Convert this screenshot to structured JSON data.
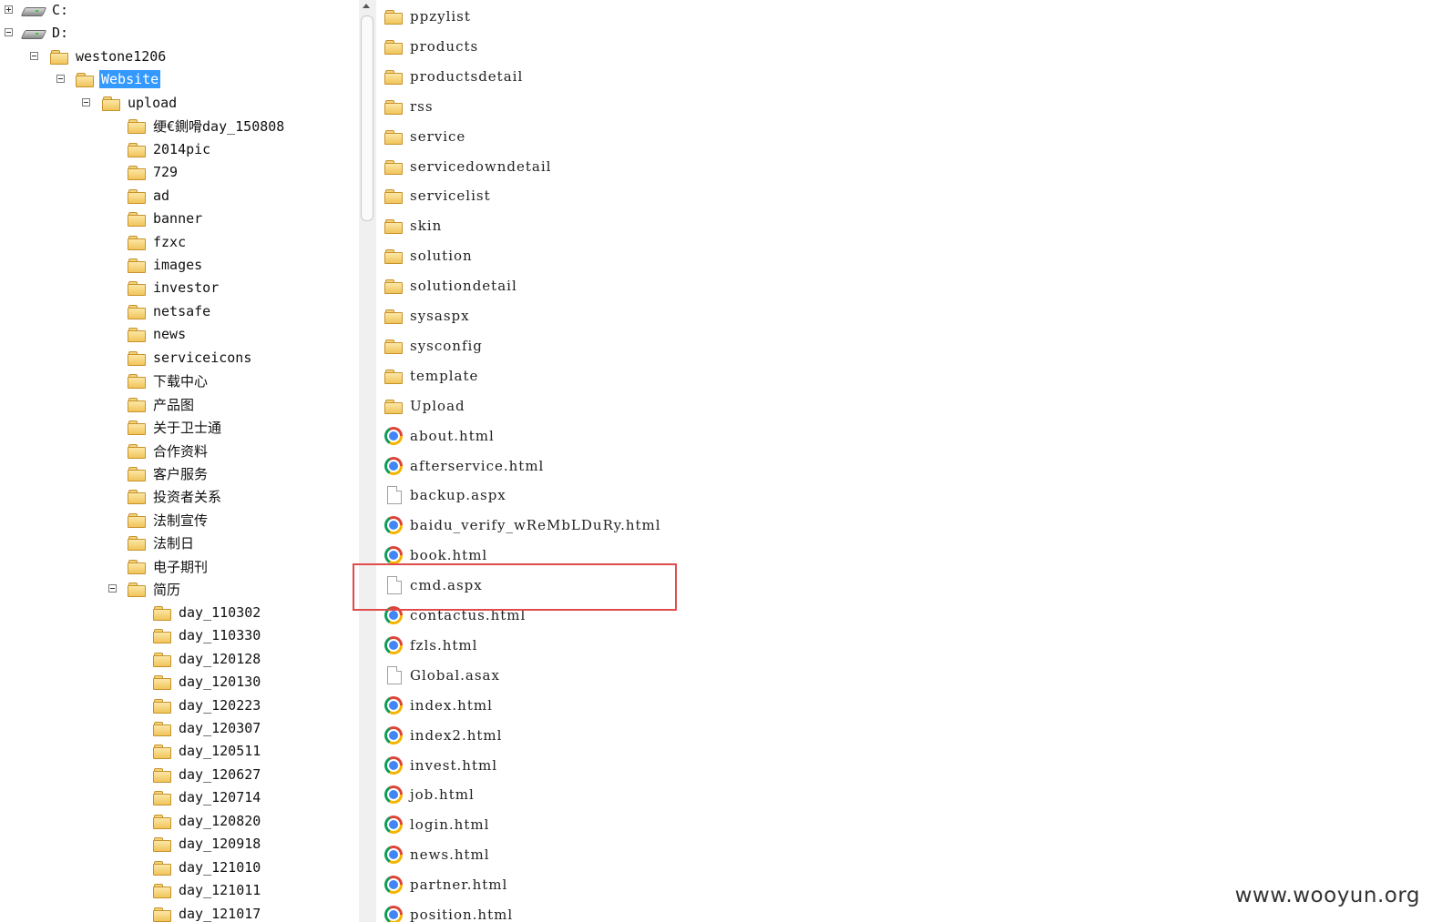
{
  "tree": {
    "drives": [
      {
        "label": "C:",
        "expander": "plus"
      },
      {
        "label": "D:",
        "expander": "minus"
      }
    ],
    "root": "westone1206",
    "website": "Website",
    "upload": "upload",
    "upload_children": [
      "绠€鍘嗗day_150808",
      "2014pic",
      "729",
      "ad",
      "banner",
      "fzxc",
      "images",
      "investor",
      "netsafe",
      "news",
      "serviceicons",
      "下载中心",
      "产品图",
      "关于卫士通",
      "合作资料",
      "客户服务",
      "投资者关系",
      "法制宣传",
      "法制日",
      "电子期刊"
    ],
    "resume_folder": "简历",
    "resume_children": [
      "day_110302",
      "day_110330",
      "day_120128",
      "day_120130",
      "day_120223",
      "day_120307",
      "day_120511",
      "day_120627",
      "day_120714",
      "day_120820",
      "day_120918",
      "day_121010",
      "day_121011",
      "day_121017"
    ]
  },
  "files": [
    {
      "name": "ppzylist",
      "icon": "folder-icon"
    },
    {
      "name": "products",
      "icon": "folder-icon"
    },
    {
      "name": "productsdetail",
      "icon": "folder-icon"
    },
    {
      "name": "rss",
      "icon": "folder-icon"
    },
    {
      "name": "service",
      "icon": "folder-icon"
    },
    {
      "name": "servicedowndetail",
      "icon": "folder-icon"
    },
    {
      "name": "servicelist",
      "icon": "folder-icon"
    },
    {
      "name": "skin",
      "icon": "folder-icon"
    },
    {
      "name": "solution",
      "icon": "folder-icon"
    },
    {
      "name": "solutiondetail",
      "icon": "folder-icon"
    },
    {
      "name": "sysaspx",
      "icon": "folder-icon"
    },
    {
      "name": "sysconfig",
      "icon": "folder-icon"
    },
    {
      "name": "template",
      "icon": "folder-icon"
    },
    {
      "name": "Upload",
      "icon": "folder-icon"
    },
    {
      "name": "about.html",
      "icon": "chrome-icon"
    },
    {
      "name": "afterservice.html",
      "icon": "chrome-icon"
    },
    {
      "name": "backup.aspx",
      "icon": "document-icon"
    },
    {
      "name": "baidu_verify_wReMbLDuRy.html",
      "icon": "chrome-icon"
    },
    {
      "name": "book.html",
      "icon": "chrome-icon"
    },
    {
      "name": "cmd.aspx",
      "icon": "document-icon"
    },
    {
      "name": "contactus.html",
      "icon": "chrome-icon"
    },
    {
      "name": "fzls.html",
      "icon": "chrome-icon"
    },
    {
      "name": "Global.asax",
      "icon": "document-icon"
    },
    {
      "name": "index.html",
      "icon": "chrome-icon"
    },
    {
      "name": "index2.html",
      "icon": "chrome-icon"
    },
    {
      "name": "invest.html",
      "icon": "chrome-icon"
    },
    {
      "name": "job.html",
      "icon": "chrome-icon"
    },
    {
      "name": "login.html",
      "icon": "chrome-icon"
    },
    {
      "name": "news.html",
      "icon": "chrome-icon"
    },
    {
      "name": "partner.html",
      "icon": "chrome-icon"
    },
    {
      "name": "position.html",
      "icon": "chrome-icon"
    }
  ],
  "highlighted_file": "cmd.aspx",
  "colors": {
    "selection": "#3399ff",
    "highlight_box": "#e24b4b"
  },
  "watermark": "www.wooyun.org"
}
